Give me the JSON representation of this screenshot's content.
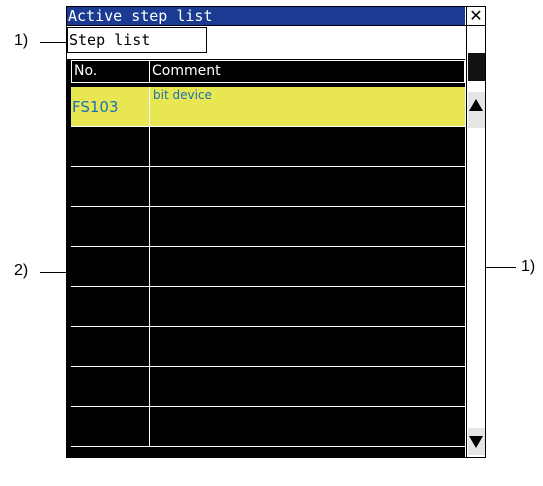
{
  "window": {
    "title": "Active step list",
    "close_glyph": "✕",
    "step_list_label": "Step list"
  },
  "table": {
    "columns": [
      "No.",
      "Comment"
    ],
    "rows": [
      {
        "no": "FS103",
        "comment": "bit device",
        "selected": true
      },
      {
        "no": "",
        "comment": "",
        "selected": false
      },
      {
        "no": "",
        "comment": "",
        "selected": false
      },
      {
        "no": "",
        "comment": "",
        "selected": false
      },
      {
        "no": "",
        "comment": "",
        "selected": false
      },
      {
        "no": "",
        "comment": "",
        "selected": false
      },
      {
        "no": "",
        "comment": "",
        "selected": false
      },
      {
        "no": "",
        "comment": "",
        "selected": false
      },
      {
        "no": "",
        "comment": "",
        "selected": false
      }
    ]
  },
  "annotations": {
    "label_1_left": "1)",
    "label_2_left": "2)",
    "label_1_right": "1)"
  },
  "colors": {
    "titlebar": "#1b3b93",
    "selected_row": "#e8e653",
    "selected_text": "#1b6fb3",
    "table_bg": "#000000"
  }
}
